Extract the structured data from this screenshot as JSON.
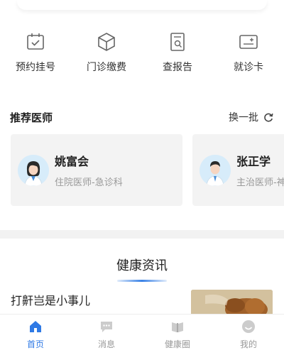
{
  "quick_actions": [
    {
      "label": "预约挂号",
      "icon": "calendar-check-icon"
    },
    {
      "label": "门诊缴费",
      "icon": "cube-icon"
    },
    {
      "label": "查报告",
      "icon": "report-search-icon"
    },
    {
      "label": "就诊卡",
      "icon": "card-icon"
    }
  ],
  "recommended": {
    "title": "推荐医师",
    "refresh_label": "换一批"
  },
  "doctors": [
    {
      "name": "姚富会",
      "title": "住院医师-急诊科"
    },
    {
      "name": "张正学",
      "title": "主治医师-神"
    }
  ],
  "news": {
    "title": "健康资讯",
    "article": "打鼾岂是小事儿"
  },
  "tabbar": [
    {
      "label": "首页",
      "icon": "home-icon",
      "active": true
    },
    {
      "label": "消息",
      "icon": "message-icon",
      "active": false
    },
    {
      "label": "健康圈",
      "icon": "health-circle-icon",
      "active": false
    },
    {
      "label": "我的",
      "icon": "profile-icon",
      "active": false
    }
  ],
  "colors": {
    "accent": "#2f7ae5",
    "icon_gray": "#666666",
    "card_bg": "#f3f3f3",
    "tab_inactive": "#cccccc"
  }
}
